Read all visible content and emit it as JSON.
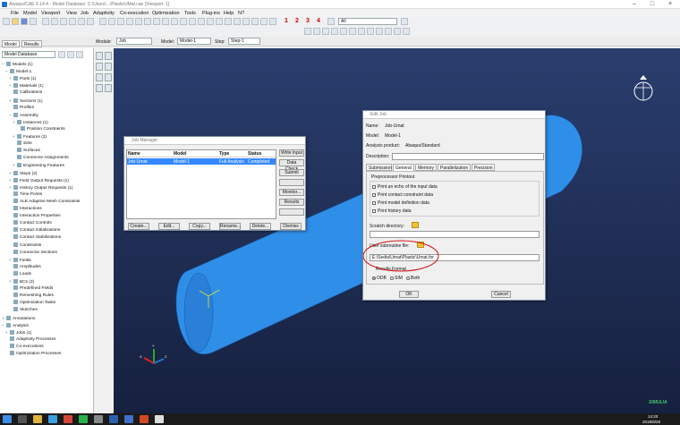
{
  "window": {
    "title": "Abaqus/CAE 6.14-4 - Model Database: C:\\Users\\...\\PlasticUMat.cae [Viewport: 1]"
  },
  "menu": [
    "File",
    "Model",
    "Viewport",
    "View",
    "Job",
    "Adaptivity",
    "Co-execution",
    "Optimization",
    "Tools",
    "Plug-ins",
    "Help",
    "N?"
  ],
  "toolbar": {
    "view_numbers": [
      "1",
      "2",
      "3",
      "4"
    ],
    "render_combo": "All"
  },
  "context": {
    "module_label": "Module:",
    "module_value": "Job",
    "model_label": "Model:",
    "model_value": "Model-1",
    "step_label": "Step:",
    "step_value": "Step-1"
  },
  "tabs": [
    "Model",
    "Results"
  ],
  "tree_combo": "Model Database",
  "tree": [
    {
      "label": "Models (1)",
      "ex": "–"
    },
    {
      "label": "Model-1",
      "ex": "–"
    },
    {
      "label": "Parts (1)",
      "ex": "+"
    },
    {
      "label": "Materials (1)",
      "ex": "+"
    },
    {
      "label": "Calibrations",
      "ex": ""
    },
    {
      "label": "Sections (1)",
      "ex": "+"
    },
    {
      "label": "Profiles",
      "ex": ""
    },
    {
      "label": "Assembly",
      "ex": "–"
    },
    {
      "label": "Instances (1)",
      "ex": "+"
    },
    {
      "label": "Position Constraints",
      "ex": ""
    },
    {
      "label": "Features (2)",
      "ex": "+"
    },
    {
      "label": "Sets",
      "ex": ""
    },
    {
      "label": "Surfaces",
      "ex": ""
    },
    {
      "label": "Connector Assignments",
      "ex": ""
    },
    {
      "label": "Engineering Features",
      "ex": "+"
    },
    {
      "label": "Steps (2)",
      "ex": "+"
    },
    {
      "label": "Field Output Requests (1)",
      "ex": "+"
    },
    {
      "label": "History Output Requests (1)",
      "ex": "+"
    },
    {
      "label": "Time Points",
      "ex": ""
    },
    {
      "label": "ALE Adaptive Mesh Constraints",
      "ex": ""
    },
    {
      "label": "Interactions",
      "ex": ""
    },
    {
      "label": "Interaction Properties",
      "ex": ""
    },
    {
      "label": "Contact Controls",
      "ex": ""
    },
    {
      "label": "Contact Initializations",
      "ex": ""
    },
    {
      "label": "Contact Stabilizations",
      "ex": ""
    },
    {
      "label": "Constraints",
      "ex": ""
    },
    {
      "label": "Connector Sections",
      "ex": ""
    },
    {
      "label": "Fields",
      "ex": "+"
    },
    {
      "label": "Amplitudes",
      "ex": ""
    },
    {
      "label": "Loads",
      "ex": ""
    },
    {
      "label": "BCs (2)",
      "ex": "+"
    },
    {
      "label": "Predefined Fields",
      "ex": ""
    },
    {
      "label": "Remeshing Rules",
      "ex": ""
    },
    {
      "label": "Optimization Tasks",
      "ex": ""
    },
    {
      "label": "Sketches",
      "ex": ""
    },
    {
      "label": "Annotations",
      "ex": "+"
    },
    {
      "label": "Analysis",
      "ex": "–"
    },
    {
      "label": "Jobs (1)",
      "ex": "+"
    },
    {
      "label": "Adaptivity Processes",
      "ex": ""
    },
    {
      "label": "Co-executions",
      "ex": ""
    },
    {
      "label": "Optimization Processes",
      "ex": ""
    }
  ],
  "job_manager": {
    "title": "Job Manager",
    "headers": [
      "Name",
      "Model",
      "Type",
      "Status"
    ],
    "rows": [
      {
        "name": "Job-Umat",
        "model": "Model-1",
        "type": "Full Analysis",
        "status": "Completed"
      }
    ],
    "side_buttons": [
      "Write Input",
      "Data Check",
      "Submit",
      "",
      "Monitor...",
      "Results",
      ""
    ],
    "bottom_buttons": [
      "Create...",
      "Edit...",
      "Copy...",
      "Rename...",
      "Delete...",
      "Dismiss"
    ]
  },
  "edit_job": {
    "title": "Edit Job",
    "name_label": "Name:",
    "name_value": "Job-Umat",
    "model_label": "Model:",
    "model_value": "Model-1",
    "product_label": "Analysis product:",
    "product_value": "Abaqus/Standard",
    "desc_label": "Description:",
    "tabs": [
      "Submission",
      "General",
      "Memory",
      "Parallelization",
      "Precision"
    ],
    "pre_title": "Preprocessor Printout",
    "checks": [
      "Print an echo of the input data",
      "Print contact constraint data",
      "Print model definition data",
      "Print history data"
    ],
    "scratch_label": "Scratch directory:",
    "user_sub_label": "User subroutine file:",
    "user_sub_value": "E:\\Sedia\\Umat\\Plastic\\Umat.for",
    "results_label": "Results Format",
    "radios": [
      "ODB",
      "SIM",
      "Both"
    ],
    "ok": "OK",
    "cancel": "Cancel"
  },
  "watermark": "SIMULIA",
  "clock": {
    "time": "14:20",
    "date": "2019/8/28"
  },
  "colors": {
    "accent": "#3388ff",
    "cylinder": "#2f8fe8",
    "selection": "#3388ff",
    "annotation": "#d01010"
  }
}
